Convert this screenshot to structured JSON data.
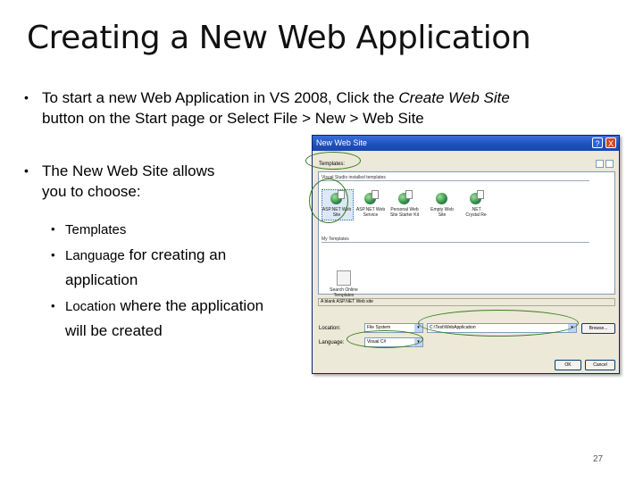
{
  "slide": {
    "title": "Creating a New Web Application",
    "bullet1": {
      "line1_prefix": "To start a new Web Application in VS 2008, Click the ",
      "line1_em": "Create Web Site",
      "line2": "button on the Start page or Select File > New > Web Site"
    },
    "bullet2": {
      "line1": "The New Web Site allows",
      "line2": "you to choose:"
    },
    "subbullets": [
      {
        "text": "Templates"
      },
      {
        "small": "Language",
        "rest": " for creating an",
        "line2": "application"
      },
      {
        "small": "Location",
        "rest": " where the application",
        "line2": "will be created"
      }
    ],
    "bullet_glyph": "•",
    "page_number": "27"
  },
  "dialog": {
    "title": "New Web Site",
    "help_glyph": "?",
    "close_glyph": "X",
    "templates_label": "Templates:",
    "installed_group": "Visual Studio installed templates",
    "templates": [
      {
        "caption1": "ASP.NET Web",
        "caption2": "Site"
      },
      {
        "caption1": "ASP.NET Web",
        "caption2": "Service"
      },
      {
        "caption1": "Personal Web",
        "caption2": "Site Starter Kit"
      },
      {
        "caption1": "Empty Web",
        "caption2": "Site"
      },
      {
        "caption1": ".NET",
        "caption2": "Crystal Re"
      }
    ],
    "my_templates_group": "My Templates",
    "search_caption1": "Search Online",
    "search_caption2": "Templates",
    "status_text": "A blank ASP.NET Web site",
    "location_label": "Location:",
    "location_value": "File System",
    "path_value": "C:\\Test\\WebApplication",
    "language_label": "Language:",
    "language_value": "Visual C#",
    "browse_label": "Browse...",
    "ok_label": "OK",
    "cancel_label": "Cancel",
    "arrow_glyph": "▾"
  },
  "colors": {
    "highlight_ellipse": "#3a7d1f",
    "titlebar": "#1c4fc0"
  }
}
